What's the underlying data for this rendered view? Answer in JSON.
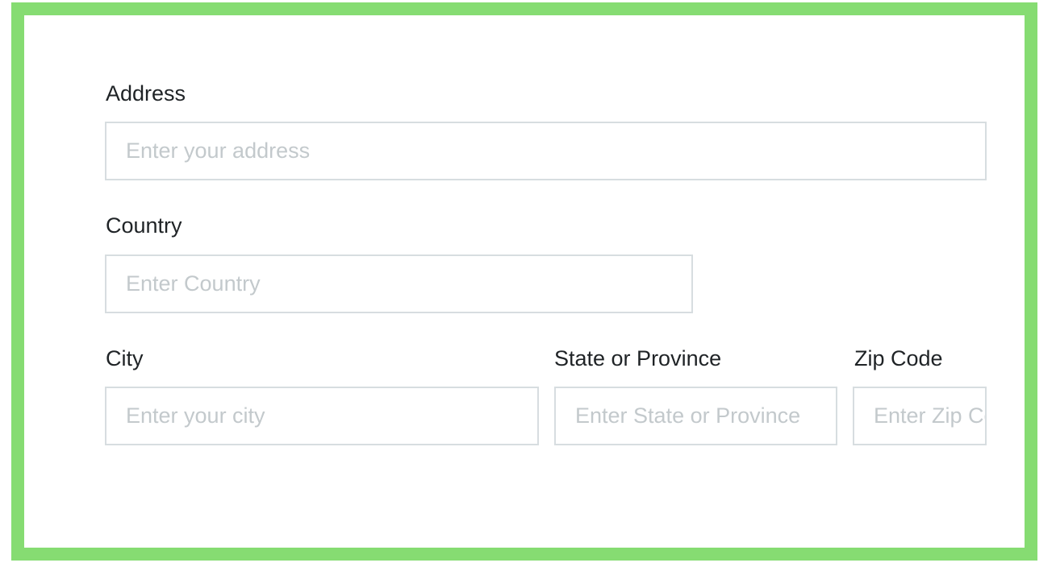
{
  "form": {
    "address": {
      "label": "Address",
      "placeholder": "Enter your address",
      "value": ""
    },
    "country": {
      "label": "Country",
      "placeholder": "Enter Country",
      "value": ""
    },
    "city": {
      "label": "City",
      "placeholder": "Enter your city",
      "value": ""
    },
    "state": {
      "label": "State or Province",
      "placeholder": "Enter State or Province",
      "value": ""
    },
    "zip": {
      "label": "Zip Code",
      "placeholder": "Enter Zip Code",
      "value": ""
    }
  },
  "colors": {
    "frame_border": "#86dc72",
    "input_border": "#d7dde0",
    "placeholder_text": "#c3c9cc",
    "label_text": "#1f2326"
  }
}
